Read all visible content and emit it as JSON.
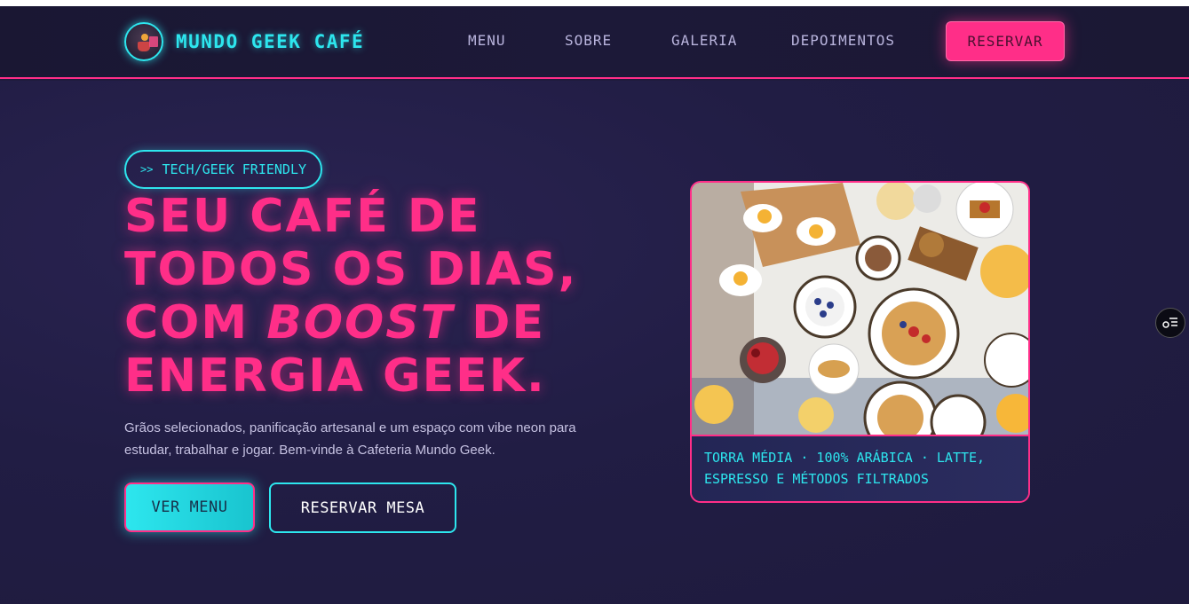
{
  "brand": {
    "name": "MUNDO GEEK CAFÉ",
    "logo_icon": "cafe-logo-icon"
  },
  "nav": {
    "links": [
      "MENU",
      "SOBRE",
      "GALERIA",
      "DEPOIMENTOS"
    ],
    "cta_label": "RESERVAR"
  },
  "hero": {
    "tag_label": "TECH/GEEK FRIENDLY",
    "tag_icon": "arrow-icon",
    "headline_line1": "SEU CAFÉ DE",
    "headline_line2": "TODOS OS DIAS,",
    "headline_line3_pre": "COM ",
    "headline_line3_em": "BOOST",
    "headline_line3_post": " DE",
    "headline_line4": "ENERGIA GEEK.",
    "subtext": "Grãos selecionados, panificação artesanal e um espaço com vibe neon para estudar, trabalhar e jogar. Bem-vinde à Cafeteria Mundo Geek.",
    "primary_button": "VER MENU",
    "secondary_button": "RESERVAR MESA"
  },
  "card": {
    "image_alt": "breakfast-table-photo",
    "caption": "TORRA MÉDIA · 100% ARÁBICA · LATTE, ESPRESSO E MÉTODOS FILTRADOS"
  },
  "colors": {
    "accent_pink": "#ff2e88",
    "accent_cyan": "#2de6ee",
    "background": "#1f1b3d"
  },
  "widget": {
    "icon": "accessibility-menu-icon"
  }
}
